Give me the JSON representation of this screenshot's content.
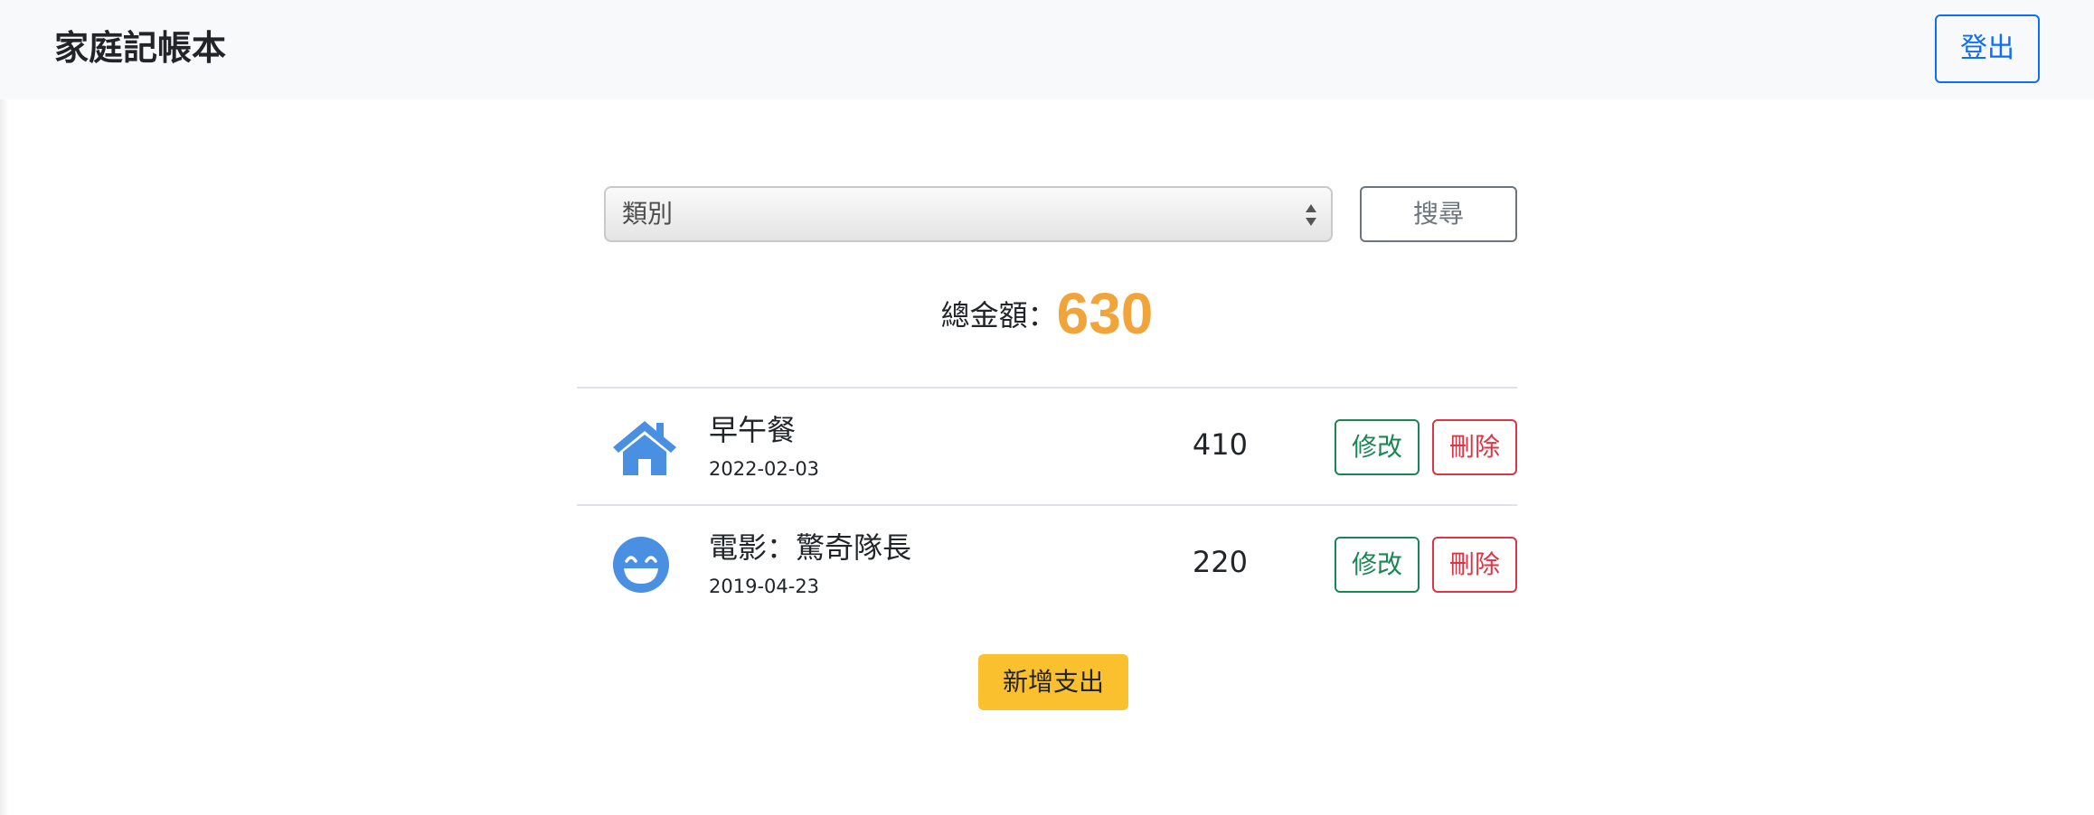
{
  "navbar": {
    "brand": "家庭記帳本",
    "logout_label": "登出"
  },
  "filter": {
    "category_selected": "類別",
    "search_label": "搜尋"
  },
  "summary": {
    "total_label": "總金額：",
    "total_value": "630"
  },
  "expenses": [
    {
      "icon": "home-icon",
      "title": "早午餐",
      "date": "2022-02-03",
      "amount": "410",
      "edit_label": "修改",
      "delete_label": "刪除"
    },
    {
      "icon": "grin-face-icon",
      "title": "電影：驚奇隊長",
      "date": "2019-04-23",
      "amount": "220",
      "edit_label": "修改",
      "delete_label": "刪除"
    }
  ],
  "actions": {
    "add_expense_label": "新增支出"
  },
  "colors": {
    "primary": "#0d6efd",
    "icon_blue": "#4a90e2",
    "total_orange": "#f0a43a",
    "success": "#198754",
    "danger": "#dc3545",
    "warning": "#fbc02d",
    "secondary": "#6c757d"
  }
}
